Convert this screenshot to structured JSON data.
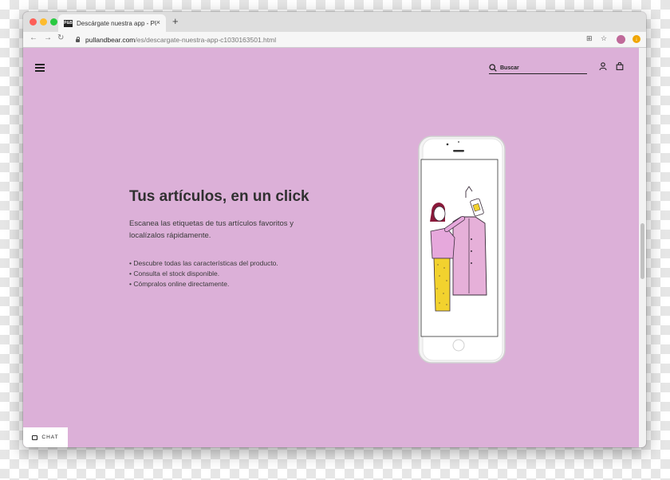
{
  "browser": {
    "tab": {
      "favicon_text": "P&B",
      "title": "Descárgate nuestra app - PULL",
      "close": "×"
    },
    "new_tab": "+",
    "url": {
      "host": "pullandbear.com",
      "path": "/es/descargate-nuestra-app-c1030163501.html"
    }
  },
  "header": {
    "search_placeholder": "Buscar"
  },
  "main": {
    "title": "Tus artículos, en un click",
    "subtitle": "Escanea las etiquetas de tus artículos favoritos y localízalos rápidamente.",
    "features": [
      "Descubre todas las características del producto.",
      "Consulta el stock disponible.",
      "Cómpralos online directamente."
    ]
  },
  "chat": {
    "label": "CHAT"
  },
  "colors": {
    "page_background": "#dcb0d8",
    "text": "#303030"
  }
}
